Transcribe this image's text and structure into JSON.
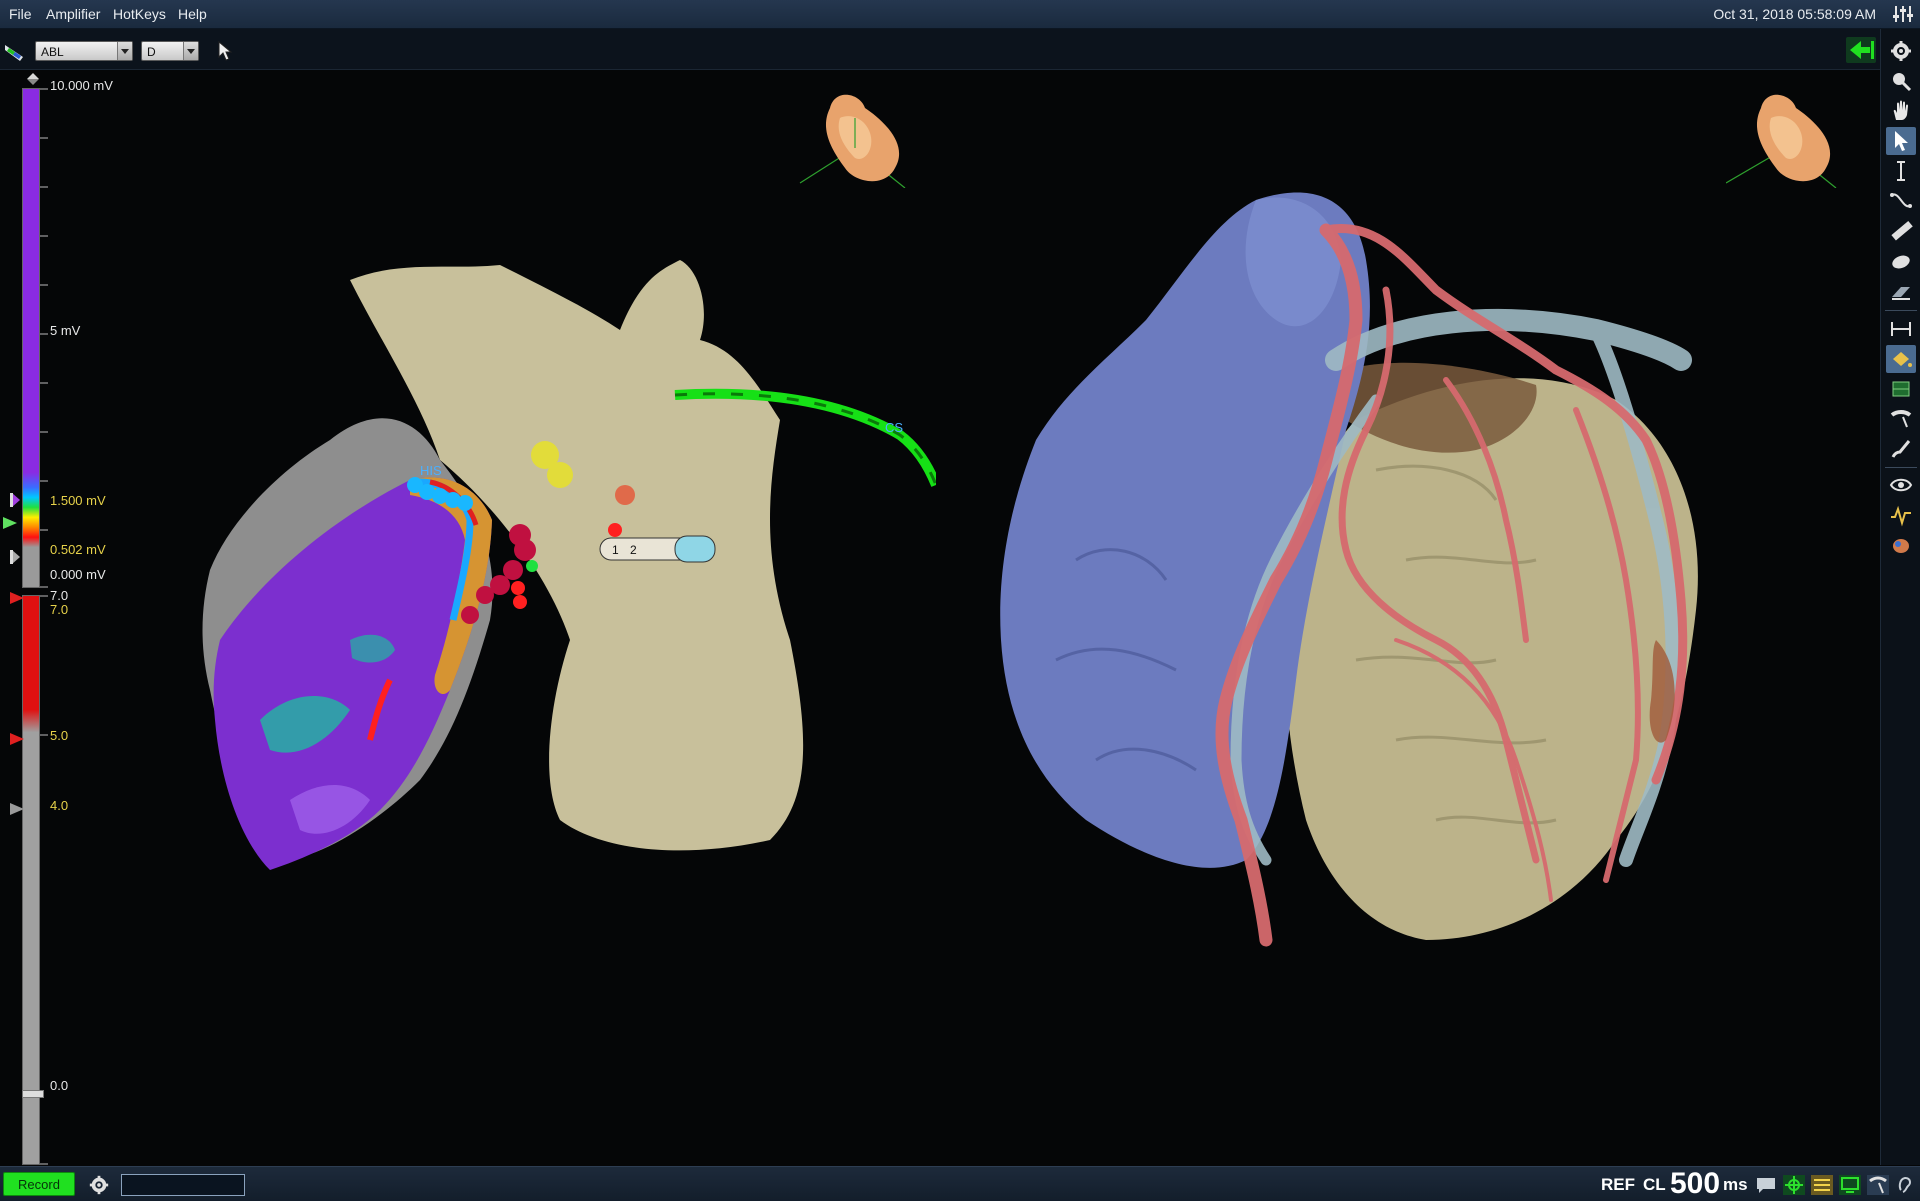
{
  "menu": {
    "items": [
      "File",
      "Amplifier",
      "HotKeys",
      "Help"
    ],
    "datetime": "Oct 31, 2018 05:58:09 AM"
  },
  "toolbar": {
    "catheter_select": "ABL",
    "mode_select": "D"
  },
  "voltage_scale": {
    "max_label": "10.000 mV",
    "mid_label": "5 mV",
    "upper_threshold": "1.500 mV",
    "lower_threshold": "0.502 mV",
    "min_label": "0.000 mV",
    "max_value_mv": 10.0,
    "upper_threshold_mv": 1.5,
    "lower_threshold_mv": 0.502,
    "min_value_mv": 0.0
  },
  "secondary_scale": {
    "top_label_a": "7.0",
    "top_label_b": "7.0",
    "mark_1": "5.0",
    "mark_2": "4.0",
    "bottom_label": "0.0"
  },
  "left_view": {
    "label_his": "HIS",
    "label_cs": "CS",
    "ablation_labels": [
      "1",
      "2"
    ]
  },
  "status": {
    "record_label": "Record",
    "ref_label": "REF",
    "cl_label": "CL",
    "cl_value": "500",
    "cl_unit": "ms"
  },
  "colors": {
    "record_green": "#20e020",
    "accent_green": "#16e016",
    "voltage_purple": "#8a2be2",
    "lat_red": "#e01010"
  }
}
